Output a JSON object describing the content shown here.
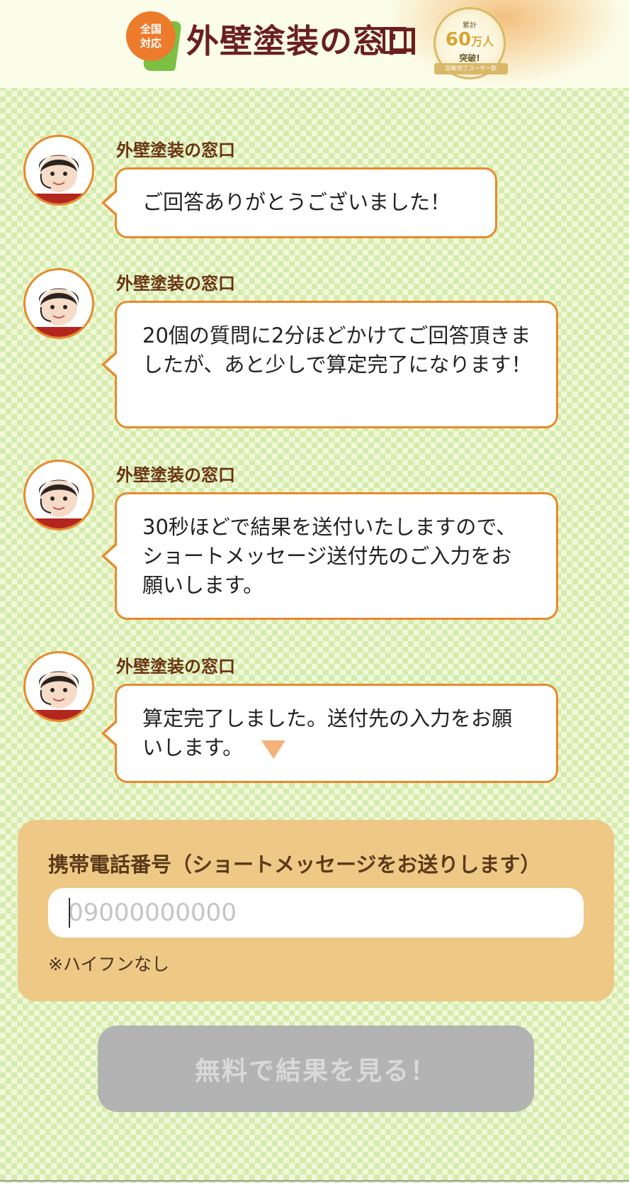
{
  "header": {
    "badge_line1": "全国",
    "badge_line2": "対応",
    "logo_text": "外壁塗装の窓口",
    "award": {
      "line1": "累計",
      "line2_num": "60",
      "line2_unit": "万人",
      "line3": "突破!",
      "ribbon": "診断完了ユーザー数"
    }
  },
  "messages": [
    {
      "sender": "外壁塗装の窓口",
      "text": "ご回答ありがとうございました！"
    },
    {
      "sender": "外壁塗装の窓口",
      "text": "20個の質問に2分ほどかけてご回答頂きましたが、あと少しで算定完了になります！"
    },
    {
      "sender": "外壁塗装の窓口",
      "text": "30秒ほどで結果を送付いたしますので、ショートメッセージ送付先のご入力をお願いします。"
    },
    {
      "sender": "外壁塗装の窓口",
      "text": "算定完了しました。送付先の入力をお願いします。"
    }
  ],
  "form": {
    "label": "携帯電話番号（ショートメッセージをお送りします）",
    "phone_value": "",
    "phone_placeholder": "09000000000",
    "note": "※ハイフンなし"
  },
  "submit_label": "無料で結果を見る！",
  "colors": {
    "accent_orange": "#e88a2c",
    "brand_brown": "#6a1f1f",
    "panel": "#eec986",
    "disabled_button": "#b3b3b3"
  }
}
